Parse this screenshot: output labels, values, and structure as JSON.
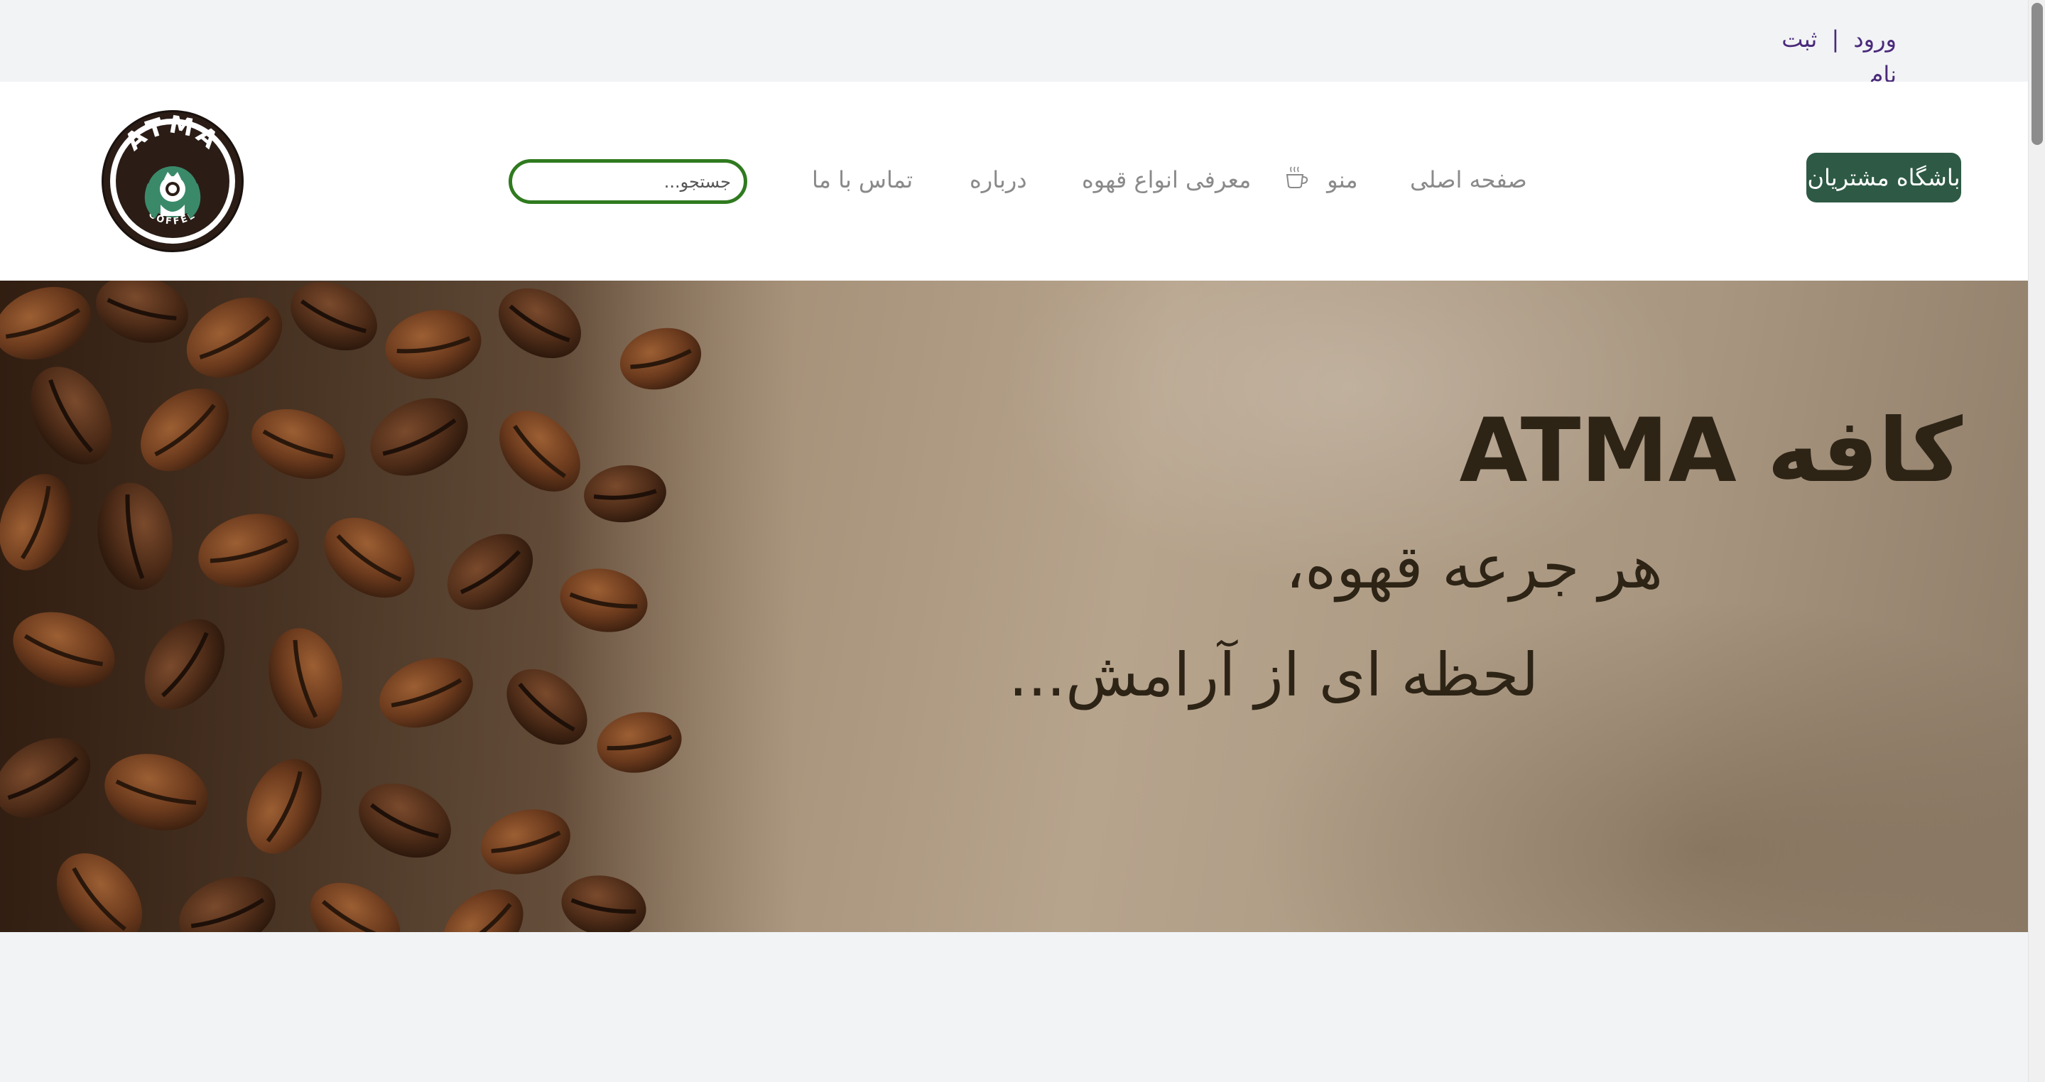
{
  "topbar": {
    "login": "ورود",
    "separator": "|",
    "register": "ثبت نام"
  },
  "header": {
    "logo": {
      "top_text": "ATMA",
      "bottom_text": "COFFEE"
    },
    "search_placeholder": "جستجو...",
    "nav": {
      "home": "صفحه اصلی",
      "menu": "منو",
      "coffee_types": "معرفی انواع قهوه",
      "about": "درباره",
      "contact": "تماس با ما"
    },
    "club_button": "باشگاه مشتریان"
  },
  "hero": {
    "title": "کافه ATMA",
    "line1": "هر جرعه قهوه،",
    "line2": "لحظه ای از آرامش..."
  },
  "colors": {
    "accent_green": "#2e5a45",
    "search_border": "#2f7a1f",
    "auth_link": "#4a2a7a",
    "hero_text": "#2d2416"
  }
}
